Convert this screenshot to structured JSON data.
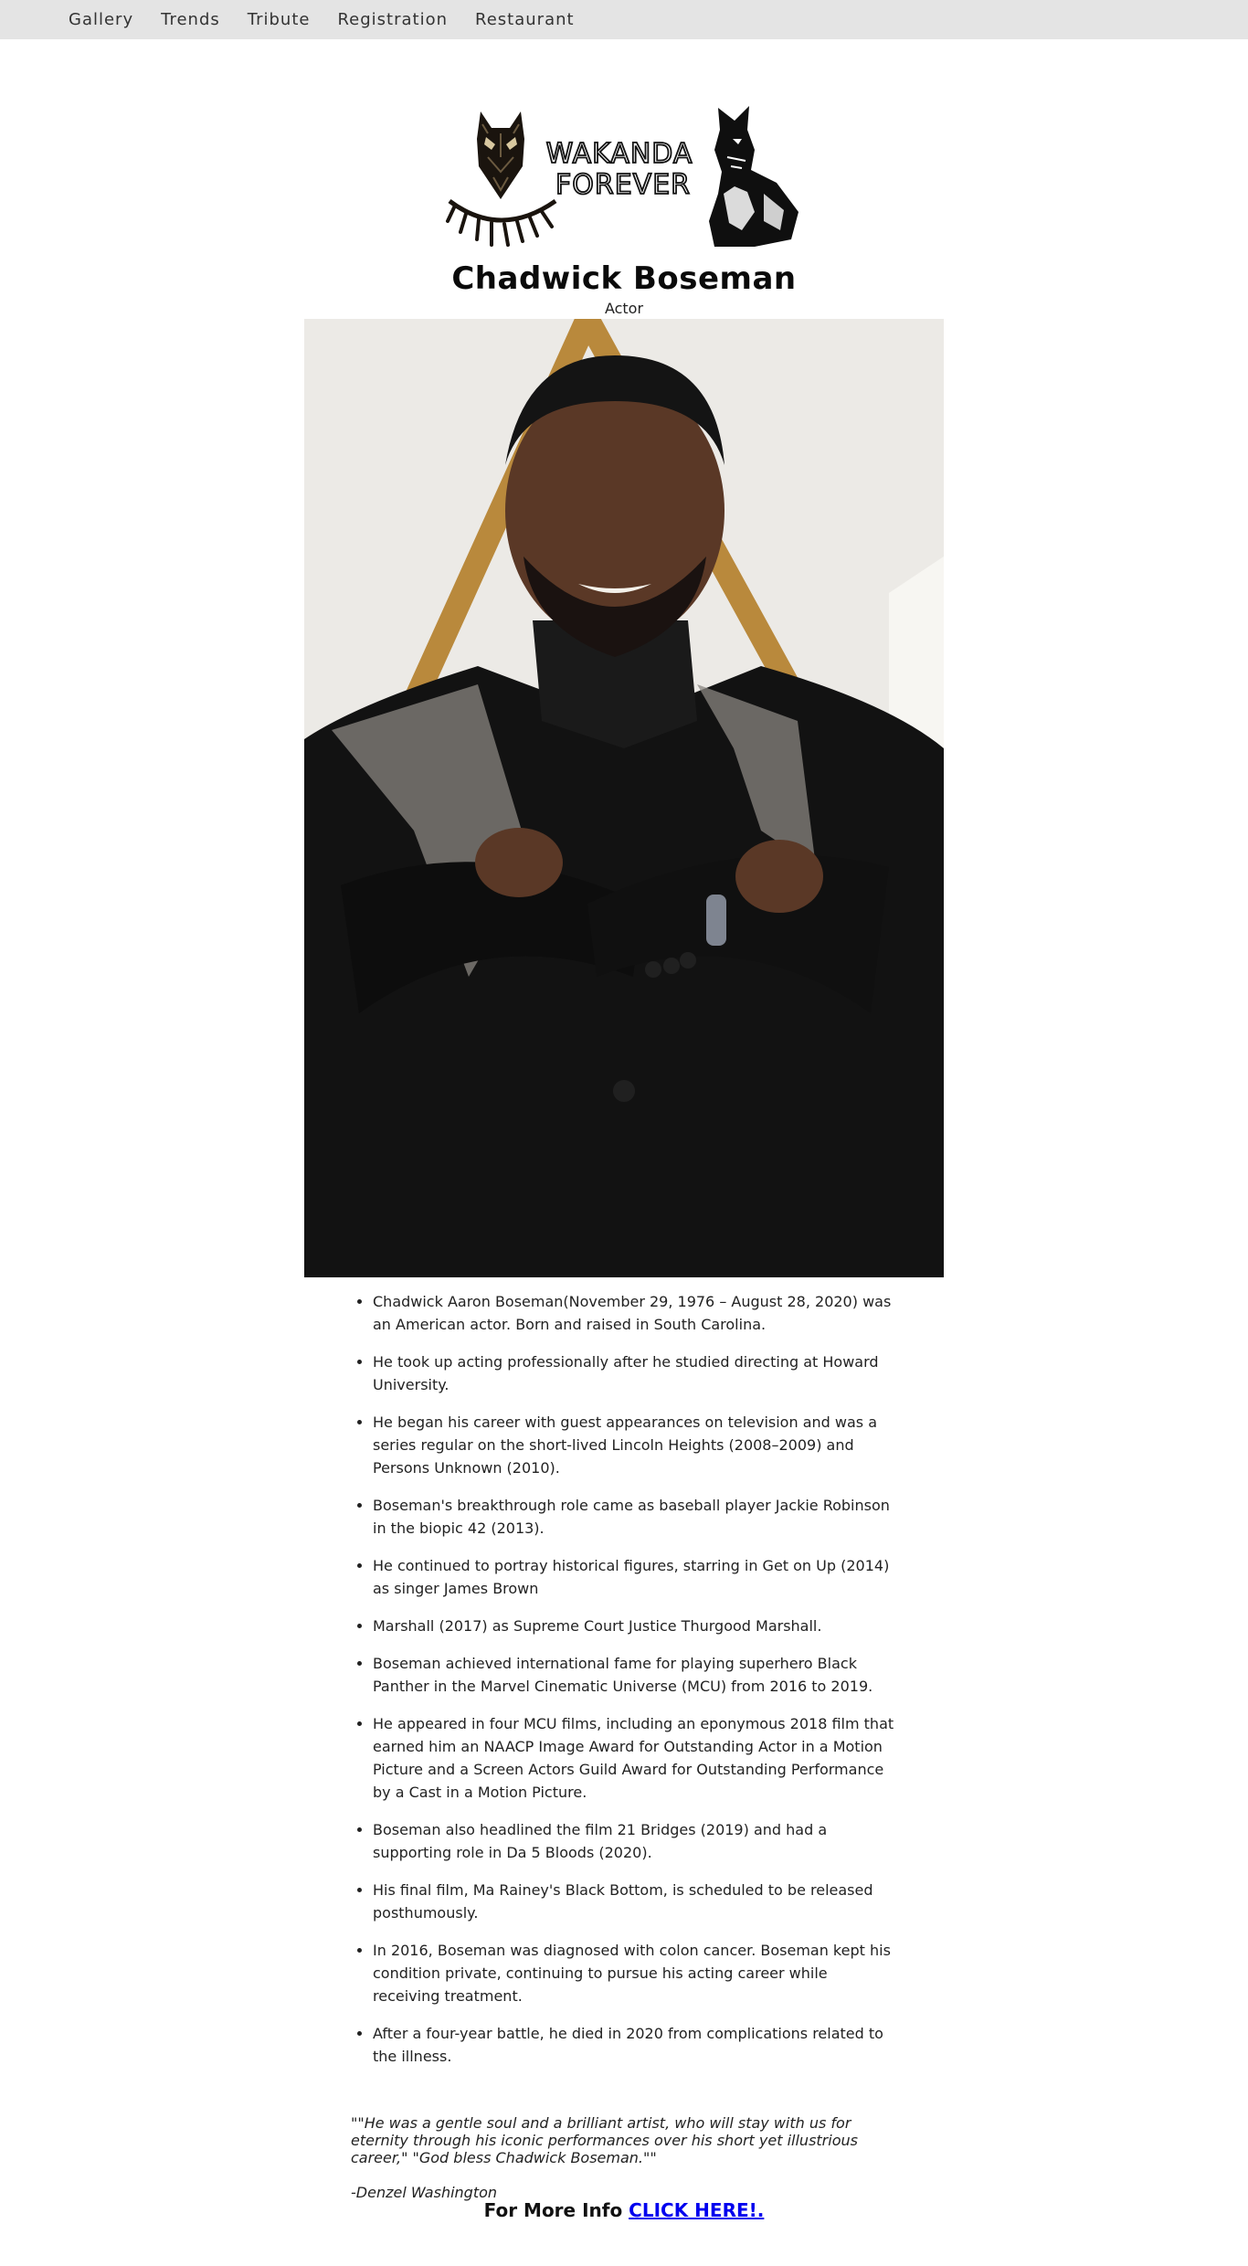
{
  "nav": {
    "items": [
      "Gallery",
      "Trends",
      "Tribute",
      "Registration",
      "Restaurant"
    ]
  },
  "logo": {
    "line1": "WAKANDA",
    "line2": "FOREVER"
  },
  "profile": {
    "name": "Chadwick Boseman",
    "role": "Actor"
  },
  "facts": [
    "Chadwick Aaron Boseman(November 29, 1976 – August 28, 2020) was an American actor. Born and raised in South Carolina.",
    "He took up acting professionally after he studied directing at Howard University.",
    "He began his career with guest appearances on television and was a series regular on the short-lived Lincoln Heights (2008–2009) and Persons Unknown (2010).",
    "Boseman's breakthrough role came as baseball player Jackie Robinson in the biopic 42 (2013).",
    "He continued to portray historical figures, starring in Get on Up (2014) as singer James Brown",
    "Marshall (2017) as Supreme Court Justice Thurgood Marshall.",
    "Boseman achieved international fame for playing superhero Black Panther in the Marvel Cinematic Universe (MCU) from 2016 to 2019.",
    "He appeared in four MCU films, including an eponymous 2018 film that earned him an NAACP Image Award for Outstanding Actor in a Motion Picture and a Screen Actors Guild Award for Outstanding Performance by a Cast in a Motion Picture.",
    "Boseman also headlined the film 21 Bridges (2019) and had a supporting role in Da 5 Bloods (2020).",
    "His final film, Ma Rainey's Black Bottom, is scheduled to be released posthumously.",
    "In 2016, Boseman was diagnosed with colon cancer. Boseman kept his condition private, continuing to pursue his acting career while receiving treatment.",
    "After a four-year battle, he died in 2020 from complications related to the illness."
  ],
  "quote": {
    "text": "\"\"He was a gentle soul and a brilliant artist, who will stay with us for eternity through his iconic performances over his short yet illustrious career,\" \"God bless Chadwick Boseman.\"\"",
    "author": "-Denzel Washington"
  },
  "more_info": {
    "label": "For More Info",
    "link_text": "CLICK HERE!."
  }
}
